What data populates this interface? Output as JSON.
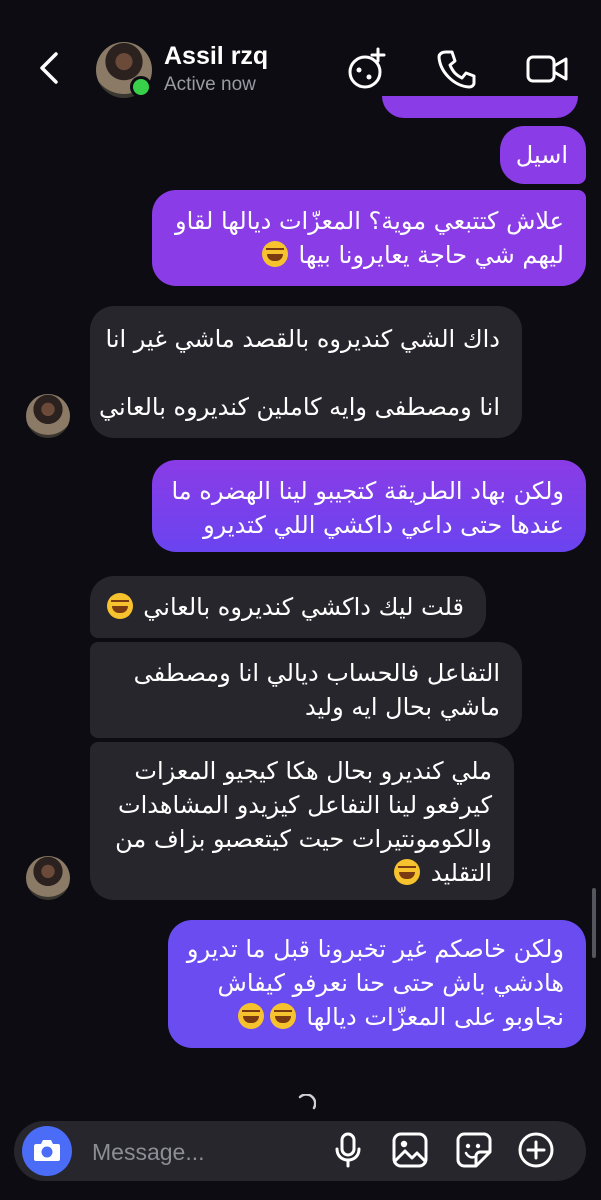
{
  "header": {
    "contact_name": "Assil rzq",
    "status": "Active now"
  },
  "messages": [
    {
      "sender": "me",
      "lines": [
        "اسيل"
      ]
    },
    {
      "sender": "me",
      "lines": [
        "علاش كتتبعي موية؟ المعزّات ديالها لقاو",
        "ليهم شي حاجة يعايرونا بيها"
      ],
      "emoji": "😂"
    },
    {
      "sender": "them",
      "lines": [
        "داك الشي كنديروه بالقصد ماشي غير انا",
        "انا ومصطفى وايه كاملين كنديروه بالعاني"
      ]
    },
    {
      "sender": "me",
      "lines": [
        "ولكن بهاد الطريقة كتجيبو لينا الهضره ما",
        "عندها حتى داعي داكشي اللي كتديرو"
      ]
    },
    {
      "sender": "them",
      "lines": [
        "قلت ليك داكشي كنديروه بالعاني"
      ],
      "emoji": "😂"
    },
    {
      "sender": "them",
      "lines": [
        "التفاعل فالحساب ديالي انا ومصطفى",
        "ماشي بحال ايه وليد"
      ]
    },
    {
      "sender": "them",
      "lines": [
        "ملي كنديرو بحال هكا كيجيو المعزات",
        "كيرفعو لينا التفاعل كيزيدو المشاهدات",
        "والكومونتيرات حيت كيتعصبو بزاف من",
        "التقليد"
      ],
      "emoji": "😂"
    },
    {
      "sender": "me",
      "lines": [
        "ولكن خاصكم غير تخبرونا قبل ما تديرو",
        "هادشي باش حتى حنا نعرفو كيفاش",
        "نجاوبو على المعزّات ديالها"
      ],
      "emoji": "😂 😂"
    }
  ],
  "composer": {
    "placeholder": "Message..."
  },
  "icons": {
    "back": "chevron-left-icon",
    "game": "game-controller-icon",
    "call": "phone-icon",
    "video": "video-camera-icon",
    "camera": "camera-icon",
    "mic": "microphone-icon",
    "gallery": "image-icon",
    "sticker": "sticker-icon",
    "add": "plus-circle-icon"
  },
  "colors": {
    "background": "#0c0c12",
    "my_bubble": "#8a3ce6",
    "my_bubble_alt": "#6b4cf0",
    "their_bubble": "#26262c",
    "online": "#38d04a",
    "camera_button": "#4a6cf7"
  }
}
